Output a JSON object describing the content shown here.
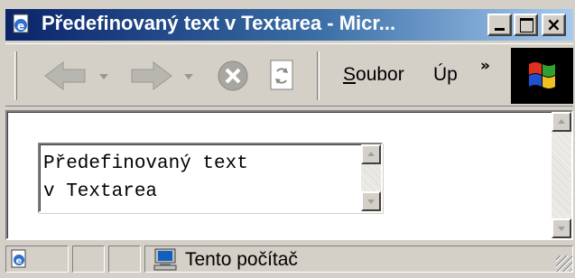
{
  "window": {
    "title": "Předefinovaný text v Textarea - Micr...",
    "icons": {
      "title": "ie-page-icon",
      "min": "minimize-icon",
      "max": "maximize-icon",
      "close": "close-icon"
    }
  },
  "toolbar": {
    "icons": {
      "back": "back-arrow-icon",
      "forward": "forward-arrow-icon",
      "stop": "stop-icon",
      "refresh": "refresh-icon",
      "more": "chevron-more-icon",
      "logo": "windows-logo-icon"
    },
    "menu": {
      "file": "Soubor",
      "edit": "Úp",
      "more_glyph": "»"
    }
  },
  "content": {
    "textarea_value": "Předefinovaný text\nv Textarea"
  },
  "statusbar": {
    "zone_text": "Tento počítač",
    "icons": {
      "page": "ie-page-icon",
      "zone": "my-computer-icon",
      "resize": "resize-grip-icon"
    }
  },
  "colors": {
    "titlebar_start": "#0a246a",
    "titlebar_end": "#a6caf0",
    "chrome": "#d4d0c8"
  }
}
